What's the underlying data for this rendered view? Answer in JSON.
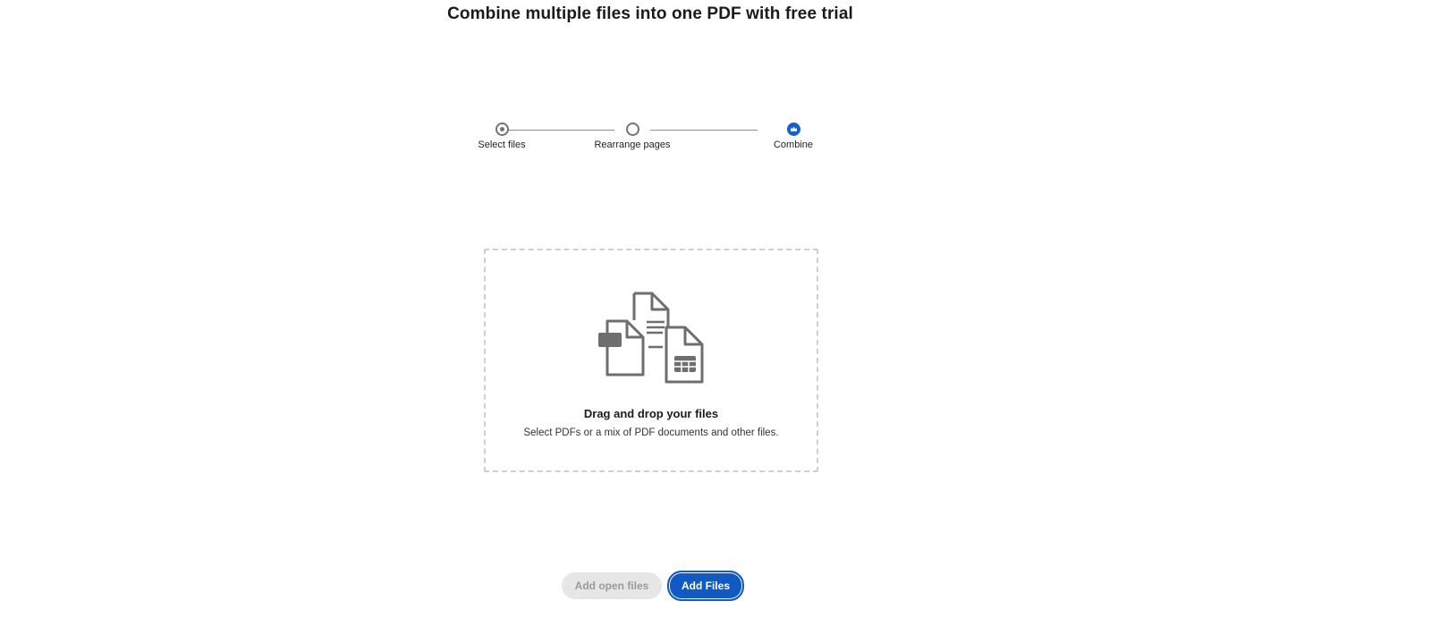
{
  "header": {
    "title": "Combine multiple files into one PDF with free trial"
  },
  "stepper": {
    "steps": [
      {
        "label": "Select files",
        "state": "current"
      },
      {
        "label": "Rearrange pages",
        "state": "upcoming"
      },
      {
        "label": "Combine",
        "state": "premium"
      }
    ]
  },
  "dropzone": {
    "heading": "Drag and drop your files",
    "subtext": "Select PDFs or a mix of PDF documents and other files.",
    "icon": "multiple-files-icon"
  },
  "actions": {
    "add_open_files_label": "Add open files",
    "add_files_label": "Add Files"
  },
  "colors": {
    "accent": "#1259c3",
    "premium_step": "#1062d3",
    "disabled_button_bg": "#e6e6e6",
    "disabled_button_text": "#9a9a9a"
  }
}
